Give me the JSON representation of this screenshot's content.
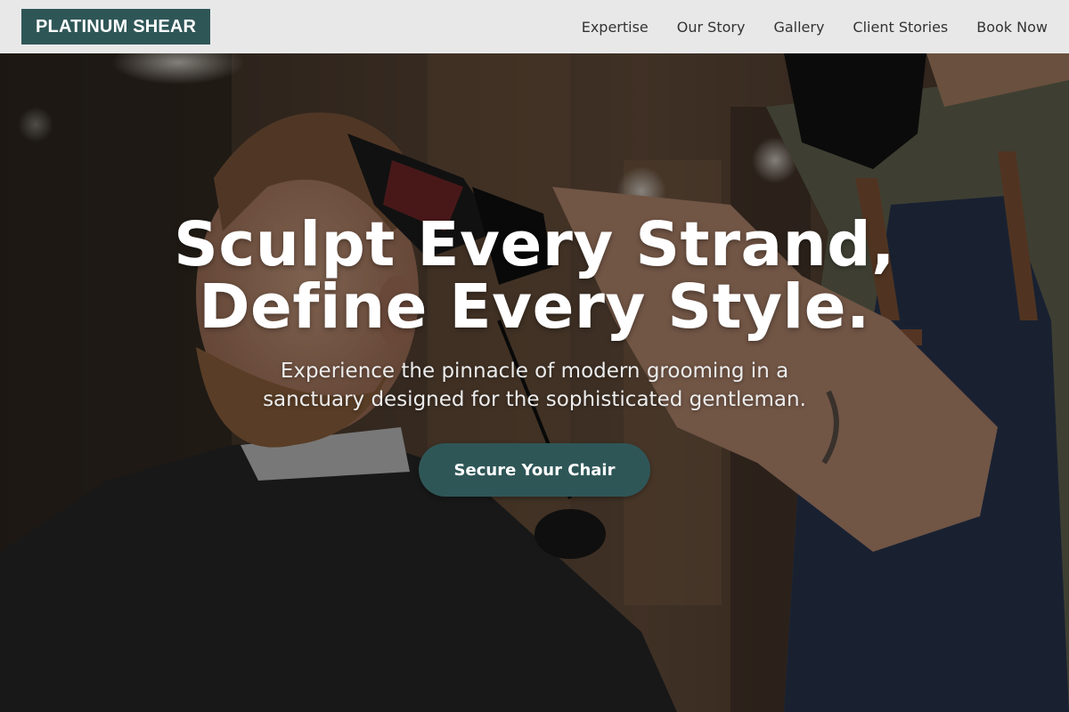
{
  "brand": {
    "logo_text": "PLATINUM SHEAR",
    "accent_color": "#2f5657"
  },
  "nav": {
    "items": [
      {
        "label": "Expertise"
      },
      {
        "label": "Our Story"
      },
      {
        "label": "Gallery"
      },
      {
        "label": "Client Stories"
      },
      {
        "label": "Book Now"
      }
    ]
  },
  "hero": {
    "headline_line1": "Sculpt Every Strand,",
    "headline_line2": "Define Every Style.",
    "subheadline": "Experience the pinnacle of modern grooming in a sanctuary designed for the sophisticated gentleman.",
    "cta_label": "Secure Your Chair",
    "background_image": "barber-styling-client-photo"
  }
}
